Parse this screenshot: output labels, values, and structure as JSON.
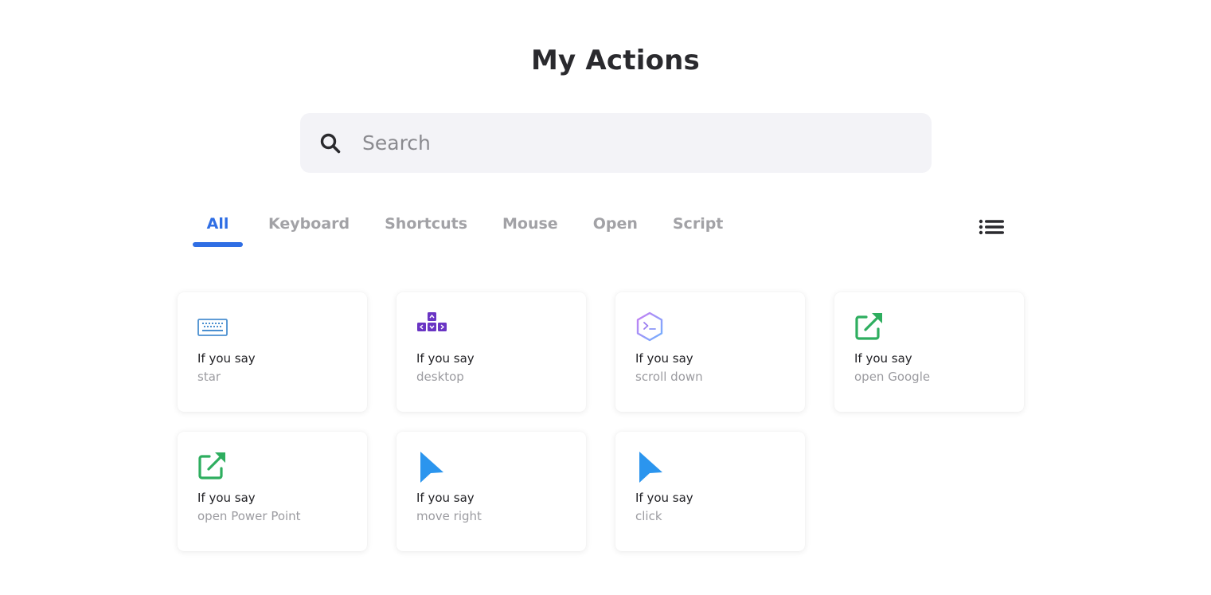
{
  "page": {
    "title": "My Actions"
  },
  "search": {
    "placeholder": "Search",
    "value": ""
  },
  "tabs": [
    {
      "label": "All",
      "active": true
    },
    {
      "label": "Keyboard",
      "active": false
    },
    {
      "label": "Shortcuts",
      "active": false
    },
    {
      "label": "Mouse",
      "active": false
    },
    {
      "label": "Open",
      "active": false
    },
    {
      "label": "Script",
      "active": false
    }
  ],
  "view_toggle": {
    "icon": "list-icon"
  },
  "colors": {
    "accent": "#2f6ee4",
    "keyboard_icon": "#4a8fd0",
    "shortcut_icon": "#6a35c4",
    "script_icon_gradient": [
      "#c77df2",
      "#6fb2ff"
    ],
    "open_icon": "#2eae5f",
    "mouse_icon": "#2b95ee"
  },
  "cards": [
    {
      "icon": "keyboard-icon",
      "prefix": "If you say",
      "phrase": "star"
    },
    {
      "icon": "arrow-keys-icon",
      "prefix": "If you say",
      "phrase": "desktop"
    },
    {
      "icon": "script-terminal-icon",
      "prefix": "If you say",
      "phrase": "scroll down"
    },
    {
      "icon": "open-external-icon",
      "prefix": "If you say",
      "phrase": "open Google"
    },
    {
      "icon": "open-external-icon",
      "prefix": "If you say",
      "phrase": "open Power Point"
    },
    {
      "icon": "mouse-pointer-icon",
      "prefix": "If you say",
      "phrase": "move right"
    },
    {
      "icon": "mouse-pointer-icon",
      "prefix": "If you say",
      "phrase": "click"
    }
  ]
}
